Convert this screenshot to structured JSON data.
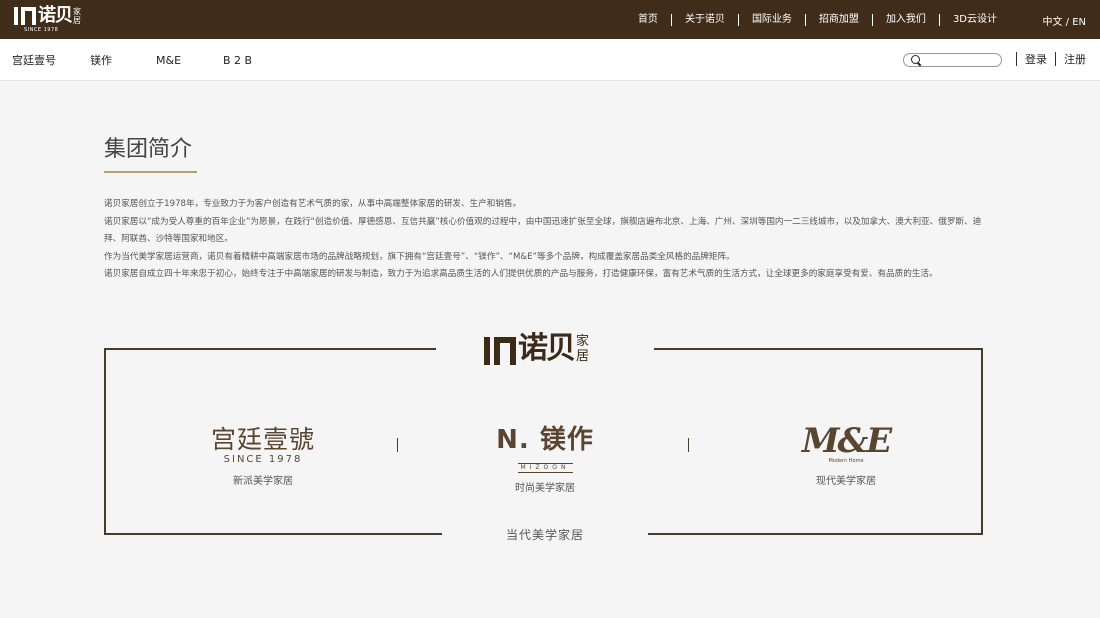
{
  "header": {
    "logo": {
      "cn": "诺贝",
      "cn_small": "家居",
      "since": "SINCE 1978"
    },
    "nav": [
      "首页",
      "关于诺贝",
      "国际业务",
      "招商加盟",
      "加入我们",
      "3D云设计"
    ],
    "lang": "中文 / EN"
  },
  "subnav": {
    "brands": [
      "宫廷壹号",
      "镁作",
      "M&E",
      "B 2 B"
    ],
    "search_placeholder": "",
    "login": "登录",
    "register": "注册"
  },
  "content": {
    "title": "集团简介",
    "paragraphs": [
      "诺贝家居创立于1978年，专业致力于为客户创造有艺术气质的家，从事中高端整体家居的研发、生产和销售。",
      "诺贝家居以“成为受人尊重的百年企业”为愿景，在践行“创造价值、厚德感恩、互信共赢”核心价值观的过程中，由中国迅速扩张至全球，旗舰店遍布北京、上海、广州、深圳等国内一二三线城市，以及加拿大、澳大利亚、俄罗斯、迪拜、阿联酋、沙特等国家和地区。",
      "作为当代美学家居运营商，诺贝有着精耕中高端家居市场的品牌战略规划，旗下拥有“宫廷壹号”、“镁作”、“M&E”等多个品牌，构成覆盖家居品类全风格的品牌矩阵。",
      "诺贝家居自成立四十年来忠于初心，始终专注于中高端家居的研发与制造，致力于为追求高品质生活的人们提供优质的产品与服务，打造健康环保，富有艺术气质的生活方式，让全球更多的家庭享受有爱、有品质的生活。"
    ]
  },
  "brand_box": {
    "center_logo": {
      "cn": "诺贝",
      "cn_small": "家居"
    },
    "brands": [
      {
        "logo_main": "宫廷壹號",
        "logo_sub": "SINCE 1978",
        "desc": "新派美学家居"
      },
      {
        "logo_main": "N. 镁作",
        "logo_sub": "MIZOON",
        "desc": "时尚美学家居"
      },
      {
        "logo_main": "M&E",
        "logo_sub": "Modern Home",
        "desc": "现代美学家居"
      }
    ],
    "bottom_label": "当代美学家居"
  },
  "colors": {
    "topbar": "#3f2d19",
    "accent": "#b99d72",
    "frame": "#4b3a27"
  }
}
